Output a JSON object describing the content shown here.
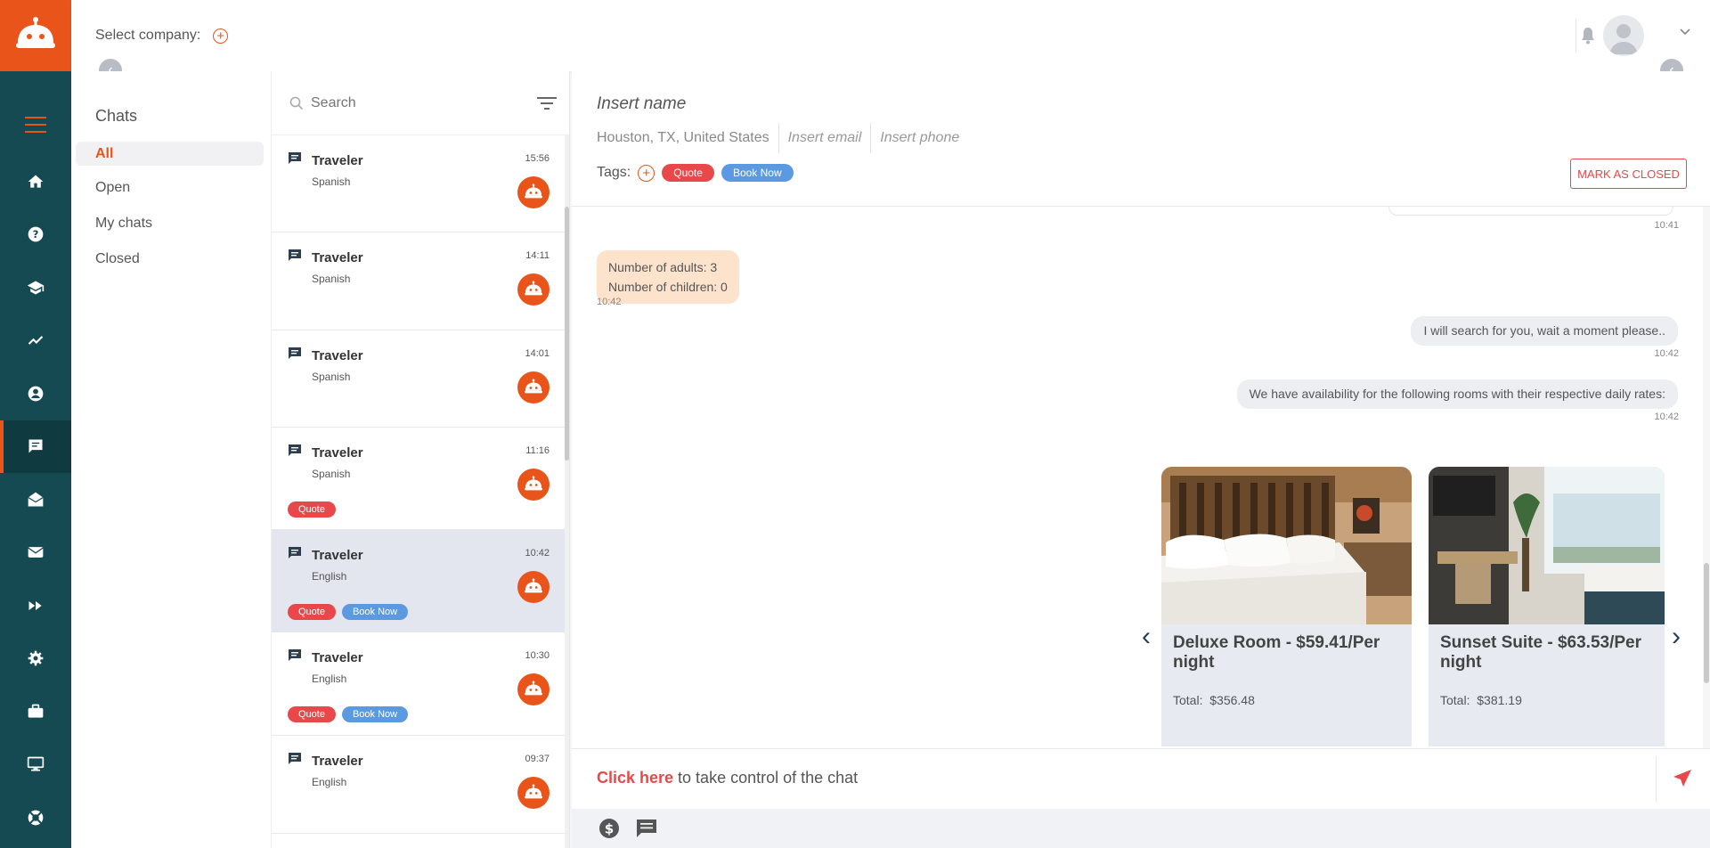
{
  "header": {
    "select_company_label": "Select company:"
  },
  "filters": {
    "title": "Chats",
    "items": [
      {
        "label": "All",
        "active": true
      },
      {
        "label": "Open",
        "active": false
      },
      {
        "label": "My chats",
        "active": false
      },
      {
        "label": "Closed",
        "active": false
      }
    ]
  },
  "search": {
    "placeholder": "Search"
  },
  "conversations": [
    {
      "name": "Traveler",
      "language": "Spanish",
      "time": "15:56",
      "tags": []
    },
    {
      "name": "Traveler",
      "language": "Spanish",
      "time": "14:11",
      "tags": []
    },
    {
      "name": "Traveler",
      "language": "Spanish",
      "time": "14:01",
      "tags": []
    },
    {
      "name": "Traveler",
      "language": "Spanish",
      "time": "11:16",
      "tags": [
        "Quote"
      ]
    },
    {
      "name": "Traveler",
      "language": "English",
      "time": "10:42",
      "tags": [
        "Quote",
        "Book Now"
      ],
      "selected": true
    },
    {
      "name": "Traveler",
      "language": "English",
      "time": "10:30",
      "tags": [
        "Quote",
        "Book Now"
      ]
    },
    {
      "name": "Traveler",
      "language": "English",
      "time": "09:37",
      "tags": []
    }
  ],
  "contact": {
    "name_placeholder": "Insert name",
    "location": "Houston, TX, United States",
    "email_placeholder": "Insert email",
    "phone_placeholder": "Insert phone",
    "tags_label": "Tags:",
    "tags": [
      "Quote",
      "Book Now"
    ],
    "mark_closed_label": "MARK AS CLOSED"
  },
  "messages": {
    "prev_time": "10:41",
    "incoming": {
      "line1": "Number of adults: 3",
      "line2": "Number of children: 0",
      "time": "10:42"
    },
    "outgoing1": {
      "text": "I will search for you, wait a moment please..",
      "time": "10:42"
    },
    "outgoing2": {
      "text": "We have availability for the following rooms with their respective daily rates:",
      "time": "10:42"
    }
  },
  "rooms": [
    {
      "title": "Deluxe Room  -  $59.41/Per night",
      "total_label": "Total:",
      "total": "$356.48"
    },
    {
      "title": "Sunset Suite  -  $63.53/Per night",
      "total_label": "Total:",
      "total": "$381.19"
    }
  ],
  "composer": {
    "link": "Click here",
    "text": " to take control of the chat"
  },
  "colors": {
    "brand": "#e8541a",
    "rail": "#154a52",
    "quote_tag": "#e8484a",
    "book_tag": "#5b9ae0"
  },
  "rail_icons": [
    "home-icon",
    "help-icon",
    "graduation-cap-icon",
    "analytics-icon",
    "account-icon",
    "chat-icon",
    "inbox-icon",
    "mail-icon",
    "fast-forward-icon",
    "settings-icon",
    "briefcase-icon",
    "monitor-icon",
    "lifebuoy-icon"
  ]
}
